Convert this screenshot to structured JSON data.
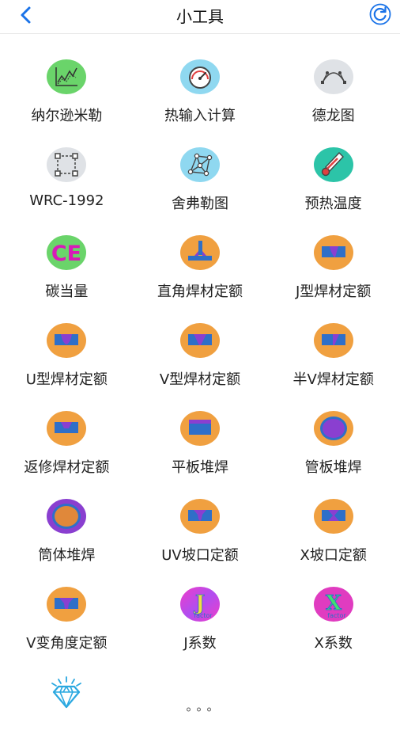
{
  "header": {
    "title": "小工具"
  },
  "tools": [
    {
      "id": "nelson",
      "label": "纳尔逊米勒",
      "icon": "chart-line-icon"
    },
    {
      "id": "heat",
      "label": "热输入计算",
      "icon": "gauge-icon"
    },
    {
      "id": "delong",
      "label": "德龙图",
      "icon": "bezier-curve-icon"
    },
    {
      "id": "wrc",
      "label": "WRC-1992",
      "icon": "selection-square-icon"
    },
    {
      "id": "schaeffler",
      "label": "舍弗勒图",
      "icon": "node-graph-icon"
    },
    {
      "id": "preheat",
      "label": "预热温度",
      "icon": "thermometer-icon"
    },
    {
      "id": "ce",
      "label": "碳当量",
      "icon": "ce-icon",
      "icon_text": "CE"
    },
    {
      "id": "fillet",
      "label": "直角焊材定额",
      "icon": "fillet-weld-icon"
    },
    {
      "id": "jgroove",
      "label": "J型焊材定额",
      "icon": "j-groove-icon"
    },
    {
      "id": "ugroove",
      "label": "U型焊材定额",
      "icon": "u-groove-icon"
    },
    {
      "id": "vgroove",
      "label": "V型焊材定额",
      "icon": "v-groove-icon"
    },
    {
      "id": "halfv",
      "label": "半V焊材定额",
      "icon": "half-v-groove-icon"
    },
    {
      "id": "repair",
      "label": "返修焊材定额",
      "icon": "repair-weld-icon"
    },
    {
      "id": "flat",
      "label": "平板堆焊",
      "icon": "flat-overlay-icon"
    },
    {
      "id": "tubesheet",
      "label": "管板堆焊",
      "icon": "tubesheet-overlay-icon"
    },
    {
      "id": "cylinder",
      "label": "筒体堆焊",
      "icon": "cylinder-overlay-icon"
    },
    {
      "id": "uv",
      "label": "UV坡口定额",
      "icon": "uv-groove-icon"
    },
    {
      "id": "xgroove",
      "label": "X坡口定额",
      "icon": "x-groove-icon"
    },
    {
      "id": "vangle",
      "label": "V变角度定额",
      "icon": "v-angle-groove-icon"
    },
    {
      "id": "jfactor",
      "label": "J系数",
      "icon": "j-factor-icon",
      "icon_text": "J",
      "icon_subtext": "factor"
    },
    {
      "id": "xfactor",
      "label": "X系数",
      "icon": "x-factor-icon",
      "icon_text": "X",
      "icon_subtext": "factor"
    },
    {
      "id": "diamond",
      "label": "",
      "icon": "diamond-icon"
    }
  ],
  "more": {
    "label": "∘∘∘"
  },
  "colors": {
    "accent_blue": "#1a73e8",
    "orange": "#f0a040",
    "weld_blue": "#2f6fc8",
    "weld_purple": "#8a3fd0",
    "green": "#6ad46a",
    "magenta": "#d81ab8",
    "teal": "#2cc4a8",
    "sky": "#8fd8f0",
    "grey": "#dfe2e6"
  }
}
